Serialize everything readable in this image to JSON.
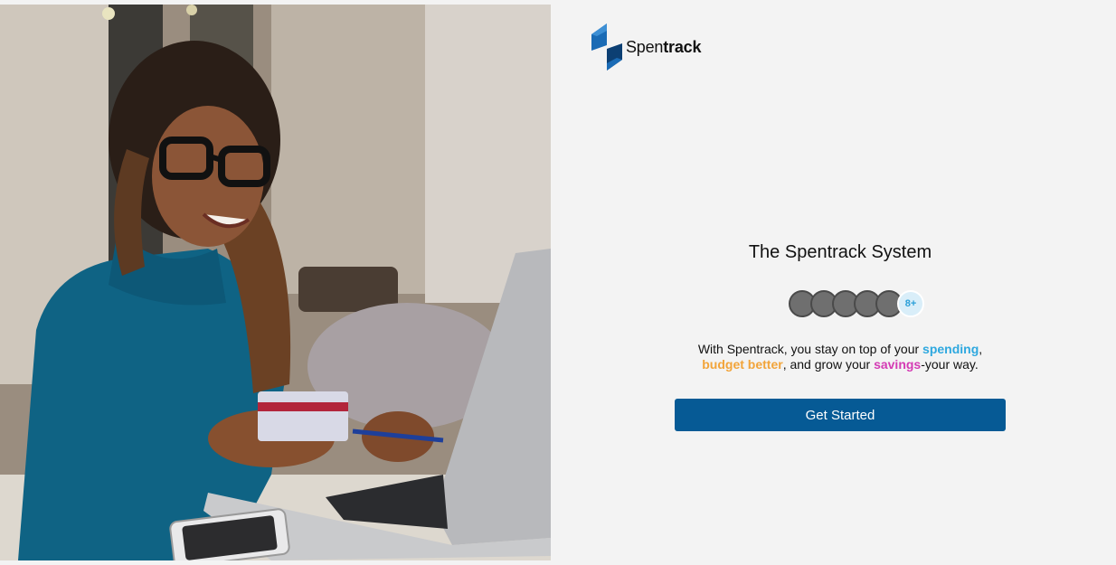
{
  "brand": {
    "name_prefix": "Spen",
    "name_suffix": "track",
    "logo_icon": "bolt-s-logo-icon",
    "logo_colors": [
      "#1a6bb5",
      "#0c3f73"
    ]
  },
  "hero": {
    "image": "photo-woman-laptop-credit-card"
  },
  "main": {
    "title": "The Spentrack System",
    "avatars": {
      "count": 5,
      "overflow_label": "8+"
    },
    "tagline": {
      "part1": "With Spentrack, you stay on top of your ",
      "highlight1": "spending",
      "part2": ",",
      "highlight2": "budget better",
      "part3": ", and grow your ",
      "highlight3": "savings",
      "part4": "-your way."
    },
    "cta_label": "Get Started"
  },
  "colors": {
    "primary": "#065a95",
    "spending": "#2ea8df",
    "budget": "#f2a43a",
    "savings": "#d43bb4",
    "background": "#f3f3f3"
  }
}
